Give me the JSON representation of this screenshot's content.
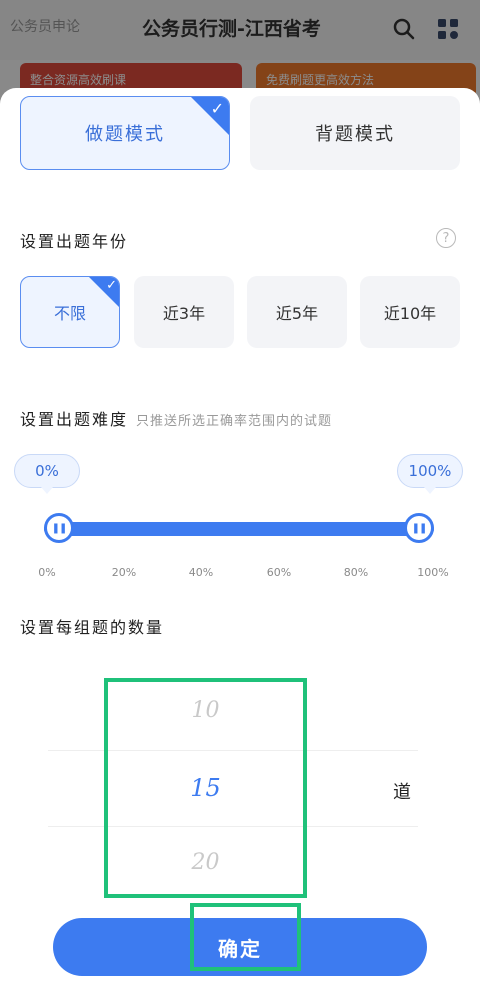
{
  "background_app": {
    "left_label": "公务员申论",
    "title": "公务员行测-江西省考",
    "search_icon": "search-icon",
    "grid_icon": "apps-grid-icon",
    "card1": "整合资源高效刷课",
    "card2": "免费刷题更高效方法"
  },
  "mode": {
    "practice_label": "做题模式",
    "memorize_label": "背题模式",
    "selected": "做题模式"
  },
  "year_section": {
    "title": "设置出题年份",
    "help_icon": "question-circle-icon",
    "options": [
      "不限",
      "近3年",
      "近5年",
      "近10年"
    ],
    "selected": "不限"
  },
  "difficulty_section": {
    "title": "设置出题难度",
    "hint": "只推送所选正确率范围内的试题",
    "low_value": "0%",
    "high_value": "100%",
    "low_fraction": 0.0,
    "high_fraction": 1.0,
    "ticks": [
      "0%",
      "20%",
      "40%",
      "60%",
      "80%",
      "100%"
    ]
  },
  "count_section": {
    "title": "设置每组题的数量",
    "options": [
      "10",
      "15",
      "20"
    ],
    "selected": "15",
    "unit": "道"
  },
  "confirm_label": "确定",
  "colors": {
    "accent": "#3d7bf0",
    "highlight": "#1fc17a"
  }
}
